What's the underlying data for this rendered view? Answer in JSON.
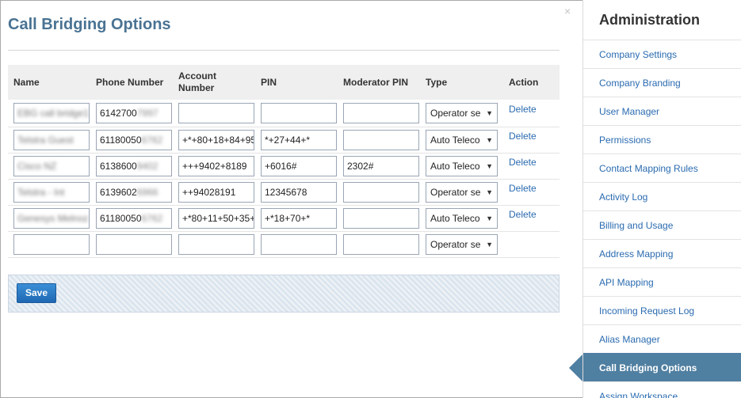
{
  "main": {
    "title": "Call Bridging Options",
    "close_glyph": "×",
    "save_label": "Save",
    "delete_label": "Delete",
    "columns": [
      "Name",
      "Phone Number",
      "Account Number",
      "PIN",
      "Moderator PIN",
      "Type",
      "Action"
    ],
    "rows": [
      {
        "name": "EBG call bridge1",
        "phone_prefix": "6142700",
        "phone_tail": "7997",
        "account": "",
        "pin": "",
        "moderator_pin": "",
        "type": "Operator se"
      },
      {
        "name": "Telstra Guest",
        "phone_prefix": "61180050",
        "phone_tail": "6762",
        "account": "+*+80+18+84+95",
        "pin": "*+27+44+*",
        "moderator_pin": "",
        "type": "Auto Teleco"
      },
      {
        "name": "Cisco NZ",
        "phone_prefix": "6138600",
        "phone_tail": "9402",
        "account": "+++9402+8189",
        "pin": "+6016#",
        "moderator_pin": "2302#",
        "type": "Auto Teleco"
      },
      {
        "name": "Telstra - Int",
        "phone_prefix": "6139602",
        "phone_tail": "6966",
        "account": "++94028191",
        "pin": "12345678",
        "moderator_pin": "",
        "type": "Operator se"
      },
      {
        "name": "Genesys Melnoz",
        "phone_prefix": "61180050",
        "phone_tail": "6762",
        "account": "+*80+11+50+35+",
        "pin": "+*18+70+*",
        "moderator_pin": "",
        "type": "Auto Teleco"
      }
    ],
    "new_row": {
      "type": "Operator se"
    }
  },
  "sidebar": {
    "title": "Administration",
    "items": [
      {
        "label": "Company Settings",
        "active": false
      },
      {
        "label": "Company Branding",
        "active": false
      },
      {
        "label": "User Manager",
        "active": false
      },
      {
        "label": "Permissions",
        "active": false
      },
      {
        "label": "Contact Mapping Rules",
        "active": false
      },
      {
        "label": "Activity Log",
        "active": false
      },
      {
        "label": "Billing and Usage",
        "active": false
      },
      {
        "label": "Address Mapping",
        "active": false
      },
      {
        "label": "API Mapping",
        "active": false
      },
      {
        "label": "Incoming Request Log",
        "active": false
      },
      {
        "label": "Alias Manager",
        "active": false
      },
      {
        "label": "Call Bridging Options",
        "active": true
      },
      {
        "label": "Assign Workspace",
        "active": false
      }
    ]
  },
  "colors": {
    "title": "#4a7393",
    "link": "#2a6bb0",
    "active_nav": "#4f7fa1",
    "save_button": "#1f68b3"
  }
}
